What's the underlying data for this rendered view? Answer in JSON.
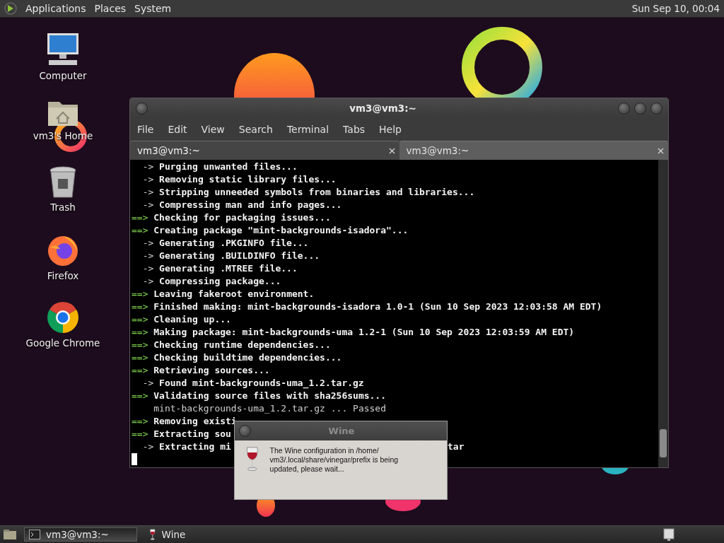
{
  "top_panel": {
    "menus": [
      "Applications",
      "Places",
      "System"
    ],
    "clock": "Sun Sep 10, 00:04"
  },
  "desktop_icons": [
    {
      "kind": "computer",
      "label": "Computer"
    },
    {
      "kind": "home",
      "label": "vm3's Home"
    },
    {
      "kind": "trash",
      "label": "Trash"
    },
    {
      "kind": "firefox",
      "label": "Firefox"
    },
    {
      "kind": "chrome",
      "label": "Google Chrome"
    }
  ],
  "terminal": {
    "title": "vm3@vm3:~",
    "menu": [
      "File",
      "Edit",
      "View",
      "Search",
      "Terminal",
      "Tabs",
      "Help"
    ],
    "tabs": [
      {
        "label": "vm3@vm3:~",
        "selected": true
      },
      {
        "label": "vm3@vm3:~",
        "selected": false
      }
    ],
    "lines": [
      {
        "kind": "sub",
        "marker": "->",
        "text": "Purging unwanted files..."
      },
      {
        "kind": "sub",
        "marker": "->",
        "text": "Removing static library files..."
      },
      {
        "kind": "sub",
        "marker": "->",
        "text": "Stripping unneeded symbols from binaries and libraries..."
      },
      {
        "kind": "sub",
        "marker": "->",
        "text": "Compressing man and info pages..."
      },
      {
        "kind": "main",
        "marker": "==>",
        "text": "Checking for packaging issues..."
      },
      {
        "kind": "main",
        "marker": "==>",
        "text": "Creating package \"mint-backgrounds-isadora\"..."
      },
      {
        "kind": "sub",
        "marker": "->",
        "text": "Generating .PKGINFO file..."
      },
      {
        "kind": "sub",
        "marker": "->",
        "text": "Generating .BUILDINFO file..."
      },
      {
        "kind": "sub",
        "marker": "->",
        "text": "Generating .MTREE file..."
      },
      {
        "kind": "sub",
        "marker": "->",
        "text": "Compressing package..."
      },
      {
        "kind": "main",
        "marker": "==>",
        "text": "Leaving fakeroot environment."
      },
      {
        "kind": "main",
        "marker": "==>",
        "text": "Finished making: mint-backgrounds-isadora 1.0-1 (Sun 10 Sep 2023 12:03:58 AM EDT)"
      },
      {
        "kind": "main",
        "marker": "==>",
        "text": "Cleaning up..."
      },
      {
        "kind": "main",
        "marker": "==>",
        "text": "Making package: mint-backgrounds-uma 1.2-1 (Sun 10 Sep 2023 12:03:59 AM EDT)"
      },
      {
        "kind": "main",
        "marker": "==>",
        "text": "Checking runtime dependencies..."
      },
      {
        "kind": "main",
        "marker": "==>",
        "text": "Checking buildtime dependencies..."
      },
      {
        "kind": "main",
        "marker": "==>",
        "text": "Retrieving sources..."
      },
      {
        "kind": "sub",
        "marker": "->",
        "text": "Found mint-backgrounds-uma_1.2.tar.gz"
      },
      {
        "kind": "main",
        "marker": "==>",
        "text": "Validating source files with sha256sums..."
      },
      {
        "kind": "plain",
        "text": "mint-backgrounds-uma_1.2.tar.gz ... Passed"
      },
      {
        "kind": "main",
        "marker": "==>",
        "text": "Removing existi"
      },
      {
        "kind": "main",
        "marker": "==>",
        "text": "Extracting sou"
      },
      {
        "kind": "sub",
        "marker": "->",
        "text": "Extracting mi",
        "tail": "tar"
      }
    ],
    "cursor_visible": true
  },
  "wine_dialog": {
    "title": "Wine",
    "message_lines": [
      "The Wine configuration in /home/",
      "vm3/.local/share/vinegar/prefix is being",
      "updated, please wait..."
    ]
  },
  "taskbar": {
    "tasks": [
      {
        "kind": "terminal",
        "label": "vm3@vm3:~",
        "selected": true
      },
      {
        "kind": "wine",
        "label": "Wine",
        "selected": false
      }
    ]
  }
}
